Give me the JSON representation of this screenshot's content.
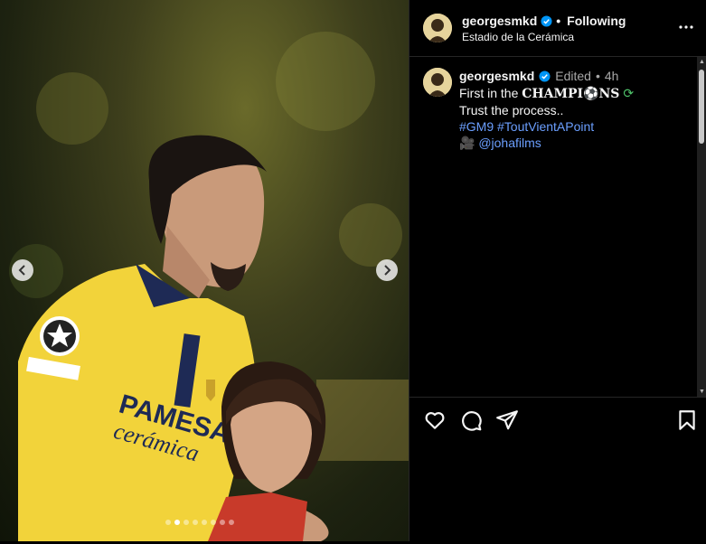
{
  "post": {
    "username": "georgesmkd",
    "follow_status": "Following",
    "location": "Estadio de la Cerámica",
    "separator": "•",
    "edited_label": "Edited",
    "time_ago": "4h",
    "caption_line1_prefix": "First in the ",
    "caption_line1_styled_a": "CHAMPI",
    "caption_line1_styled_b": "NS",
    "caption_line2": "Trust the process..",
    "hashtag1": "#GM9",
    "hashtag2": "#ToutVientAPoint",
    "mention": "@johafilms"
  },
  "carousel": {
    "slide_count": 8,
    "active_index": 1
  },
  "colors": {
    "accent_link": "#6b9fff",
    "verified": "#0095f6",
    "jersey": "#f2d33a"
  },
  "icons": [
    "verified-badge-icon",
    "more-options-icon",
    "chevron-left-icon",
    "chevron-right-icon",
    "soccer-ball-emoji",
    "camera-emoji",
    "heart-icon",
    "comment-icon",
    "share-icon",
    "bookmark-icon"
  ]
}
